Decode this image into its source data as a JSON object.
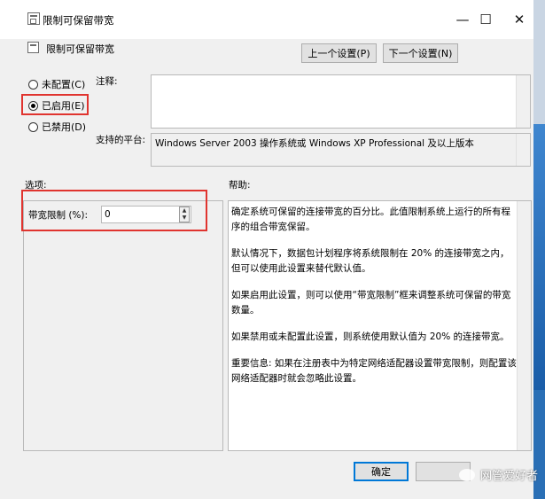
{
  "window": {
    "title": "限制可保留带宽",
    "minimize": "—",
    "maximize": "☐",
    "close": "✕"
  },
  "header": {
    "policy_title": "限制可保留带宽",
    "prev_button": "上一个设置(P)",
    "next_button": "下一个设置(N)"
  },
  "state": {
    "not_configured": "未配置(C)",
    "enabled": "已启用(E)",
    "disabled": "已禁用(D)",
    "selected": "enabled"
  },
  "comment": {
    "label": "注释:",
    "value": ""
  },
  "supported": {
    "label": "支持的平台:",
    "value": "Windows Server 2003 操作系统或 Windows XP Professional 及以上版本"
  },
  "options": {
    "label": "选项:",
    "bandwidth_label": "带宽限制 (%):",
    "bandwidth_value": "0"
  },
  "help": {
    "label": "帮助:",
    "paragraphs": [
      "确定系统可保留的连接带宽的百分比。此值限制系统上运行的所有程序的组合带宽保留。",
      "默认情况下，数据包计划程序将系统限制在 20% 的连接带宽之内，但可以使用此设置来替代默认值。",
      "如果启用此设置，则可以使用“带宽限制”框来调整系统可保留的带宽数量。",
      "如果禁用或未配置此设置，则系统使用默认值为 20% 的连接带宽。",
      "重要信息: 如果在注册表中为特定网络适配器设置带宽限制，则配置该网络适配器时就会忽略此设置。"
    ]
  },
  "footer": {
    "ok_button": "确定"
  },
  "watermark": "网管爱好者",
  "colors": {
    "highlight": "#e0342f",
    "focus": "#0078d7"
  }
}
